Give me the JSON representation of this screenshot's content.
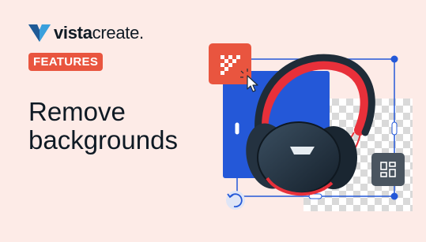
{
  "brand": {
    "name_bold": "vista",
    "name_light": "create",
    "dot": "."
  },
  "badge": {
    "label": "FEATURES"
  },
  "title": {
    "line1": "Remove",
    "line2": "backgrounds"
  },
  "icons": {
    "remove_bg_tool": "checker-remove-bg-icon",
    "cursor": "click-cursor-icon",
    "layout_tool": "grid-layout-icon",
    "rotate": "rotate-icon"
  },
  "colors": {
    "background": "#fdebe7",
    "accent": "#e9553f",
    "blue": "#2458d8",
    "text": "#0f1a24"
  }
}
